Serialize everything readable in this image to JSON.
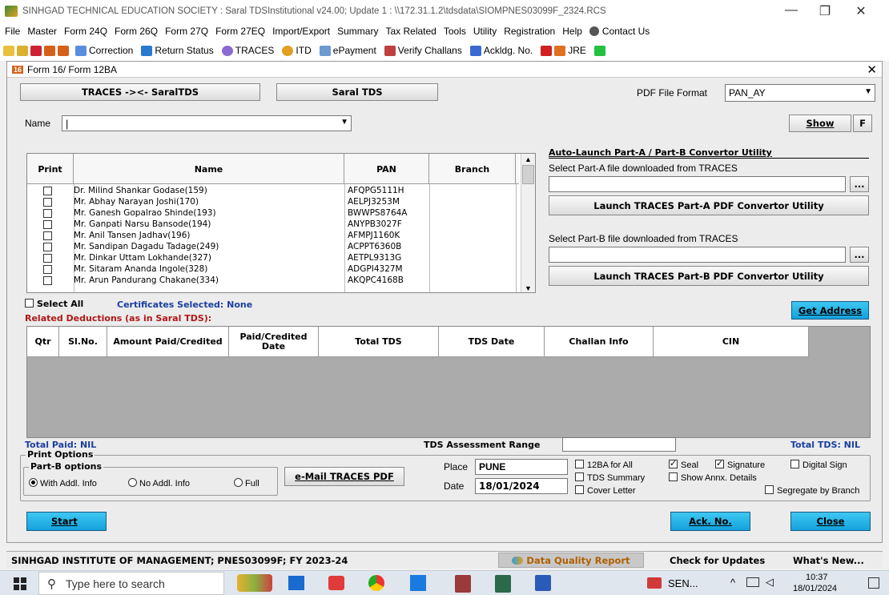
{
  "window": {
    "title": "SINHGAD TECHNICAL EDUCATION SOCIETY : Saral TDSInstitutional v24.00; Update 1 : \\\\172.31.1.2\\tdsdata\\SIOMPNES03099F_2324.RCS"
  },
  "menu": [
    "File",
    "Master",
    "Form 24Q",
    "Form 26Q",
    "Form 27Q",
    "Form 27EQ",
    "Import/Export",
    "Summary",
    "Tax Related",
    "Tools",
    "Utility",
    "Registration",
    "Help",
    "Contact Us"
  ],
  "toolbar": {
    "correction": "Correction",
    "return_status": "Return Status",
    "traces": "TRACES",
    "itd": "ITD",
    "epayment": "ePayment",
    "verify": "Verify Challans",
    "ackldg": "Ackldg. No.",
    "jre": "JRE"
  },
  "dialog": {
    "title": "Form 16/ Form 12BA",
    "tab_traces": "TRACES -><- SaralTDS",
    "tab_saral": "Saral TDS",
    "pdf_format_label": "PDF File Format",
    "pdf_format_value": "PAN_AY",
    "name_label": "Name",
    "show": "Show",
    "f": "F",
    "grid_headers": {
      "print": "Print",
      "name": "Name",
      "pan": "PAN",
      "branch": "Branch"
    },
    "rows": [
      {
        "name": "Dr. Milind Shankar Godase(159)",
        "pan": "AFQPG5111H"
      },
      {
        "name": "Mr. Abhay Narayan Joshi(170)",
        "pan": "AELPJ3253M"
      },
      {
        "name": "Mr. Ganesh Gopalrao Shinde(193)",
        "pan": "BWWPS8764A"
      },
      {
        "name": "Mr. Ganpati Narsu Bansode(194)",
        "pan": "ANYPB3027F"
      },
      {
        "name": "Mr. Anil Tansen Jadhav(196)",
        "pan": "AFMPJ1160K"
      },
      {
        "name": "Mr. Sandipan Dagadu Tadage(249)",
        "pan": "ACPPT6360B"
      },
      {
        "name": "Mr. Dinkar Uttam Lokhande(327)",
        "pan": "AETPL9313G"
      },
      {
        "name": "Mr. Sitaram Ananda Ingole(328)",
        "pan": "ADGPI4327M"
      },
      {
        "name": "Mr. Arun Pandurang Chakane(334)",
        "pan": "AKQPC4168B"
      }
    ],
    "auto_title": "Auto-Launch Part-A / Part-B Convertor Utility",
    "part_a_label": "Select Part-A file downloaded from TRACES",
    "launch_a": "Launch TRACES Part-A PDF Convertor Utility",
    "part_b_label": "Select Part-B file downloaded from TRACES",
    "launch_b": "Launch TRACES Part-B PDF Convertor Utility",
    "browse": "...",
    "select_all": "Select All",
    "cert_selected": "Certificates Selected: None",
    "get_address": "Get Address",
    "related": "Related Deductions (as in Saral TDS):",
    "ded_headers": {
      "qtr": "Qtr",
      "slno": "Sl.No.",
      "amount": "Amount Paid/Credited",
      "date": "Paid/Credited Date",
      "total_tds": "Total TDS",
      "tds_date": "TDS Date",
      "challan": "Challan Info",
      "cin": "CIN"
    },
    "total_paid": "Total Paid: NIL",
    "assessment": "TDS Assessment Range",
    "total_tds": "Total TDS: NIL",
    "print_options": "Print Options",
    "partb_options": "Part-B options",
    "opt_with": "With Addl. Info",
    "opt_no": "No Addl. Info",
    "opt_full": "Full",
    "email": "e-Mail TRACES PDF",
    "place_label": "Place",
    "place_value": "PUNE",
    "date_label": "Date",
    "date_value": "18/01/2024",
    "chk_12ba": "12BA for All",
    "chk_seal": "Seal",
    "chk_signature": "Signature",
    "chk_digital": "Digital Sign",
    "chk_summary": "TDS Summary",
    "chk_annx": "Show Annx. Details",
    "chk_cover": "Cover Letter",
    "chk_segregate": "Segregate by Branch",
    "start": "Start",
    "ack": "Ack. No.",
    "close": "Close"
  },
  "status": {
    "org": "SINHGAD INSTITUTE OF MANAGEMENT; PNES03099F; FY 2023-24",
    "dq": "Data Quality Report",
    "updates": "Check for Updates",
    "whatsnew": "What's New..."
  },
  "taskbar": {
    "search": "Type here to search",
    "sen": "SEN...",
    "time": "10:37",
    "date": "18/01/2024"
  }
}
